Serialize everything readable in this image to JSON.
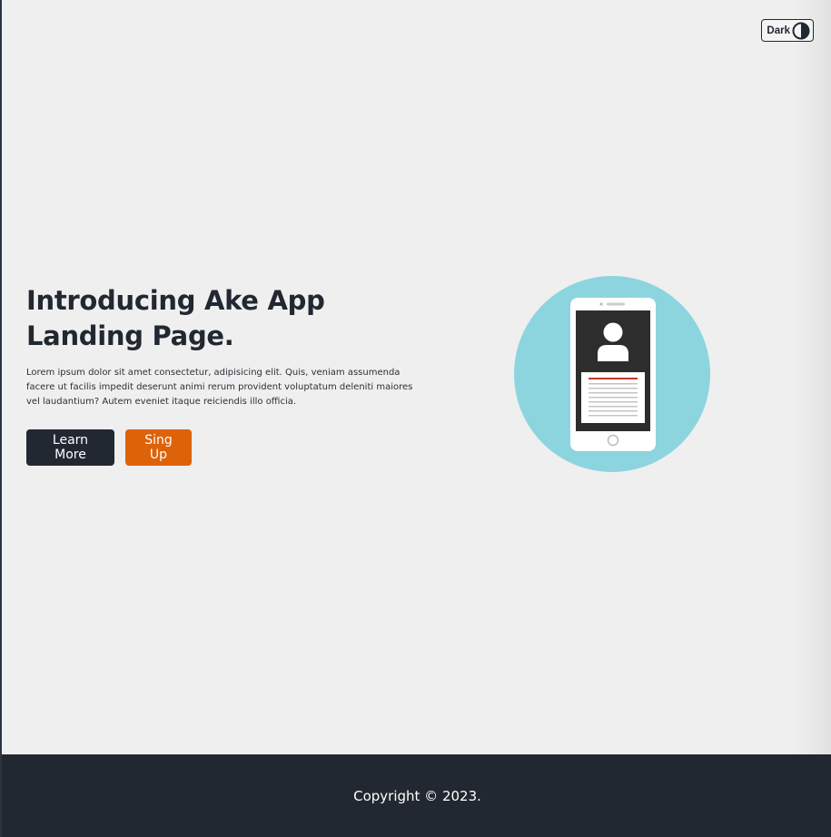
{
  "theme_toggle": {
    "label": "Dark",
    "icon": "half-circle-contrast-icon"
  },
  "hero": {
    "title_line1": "Introducing Ake App",
    "title_line2": "Landing Page.",
    "description": "Lorem ipsum dolor sit amet consectetur, adipisicing elit. Quis, veniam assumenda facere ut facilis impedit deserunt animi rerum provident voluptatum deleniti maiores vel laudantium? Autem eveniet itaque reiciendis illo officia.",
    "learn_more_label": "Learn More",
    "sign_up_label": "Sing Up"
  },
  "illustration": {
    "icon": "smartphone-profile-icon",
    "circle_color": "#8cd5df"
  },
  "footer": {
    "copyright": "Copyright © 2023."
  },
  "colors": {
    "dark": "#222831",
    "accent": "#de6208",
    "background": "#efefef"
  }
}
